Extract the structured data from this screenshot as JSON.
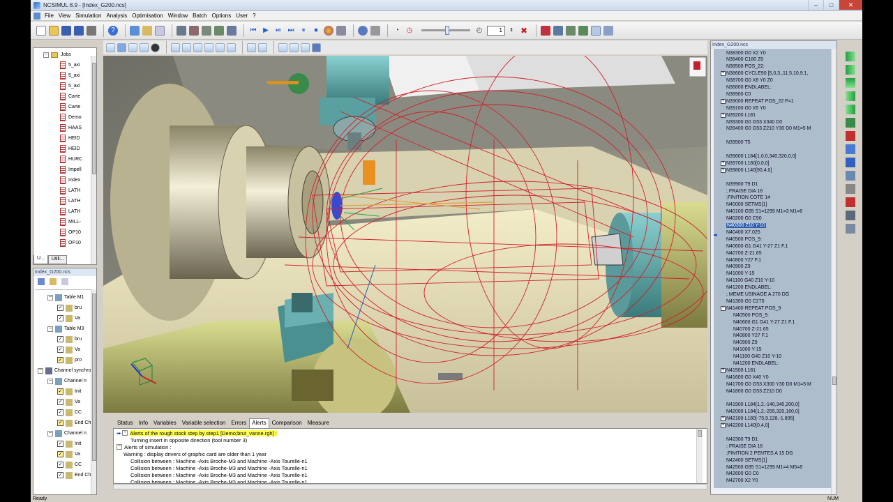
{
  "window": {
    "title": "NCSIMUL 8.9 - [Index_G200.ncs]",
    "minimize": "–",
    "maximize": "□",
    "close": "✕"
  },
  "menu": [
    "File",
    "View",
    "Simulation",
    "Analysis",
    "Optimisation",
    "Window",
    "Batch",
    "Options",
    "User",
    "?"
  ],
  "toolbar": {
    "step_value": "1"
  },
  "left": {
    "jobs_root": "Jobs",
    "jobs": [
      "5_axi",
      "5_axi",
      "5_axi",
      "Carte",
      "Carte",
      "Demo",
      "HAAS",
      "HEID",
      "HEID",
      "HURC",
      "Impell",
      "Index",
      "LATH",
      "LATH",
      "LATH",
      "MILL-",
      "OP10",
      "OP10"
    ],
    "tabs": [
      "U...",
      "Utili..."
    ],
    "file_panel_title": "Index_G200.ncs",
    "tree": [
      {
        "label": "Table M1",
        "level": 1
      },
      {
        "label": "bru",
        "level": 2
      },
      {
        "label": "Va",
        "level": 2
      },
      {
        "label": "Table M3",
        "level": 1
      },
      {
        "label": "bru",
        "level": 2
      },
      {
        "label": "Va",
        "level": 2
      },
      {
        "label": "pro",
        "level": 2
      },
      {
        "label": "Channel synchro",
        "level": 0
      },
      {
        "label": "Channel n",
        "level": 1
      },
      {
        "label": "Init",
        "level": 2
      },
      {
        "label": "Va",
        "level": 2
      },
      {
        "label": "CC",
        "level": 2
      },
      {
        "label": "End Ch",
        "level": 2
      },
      {
        "label": "Channel n",
        "level": 1
      },
      {
        "label": "Init",
        "level": 2
      },
      {
        "label": "Va",
        "level": 2
      },
      {
        "label": "CC",
        "level": 2
      },
      {
        "label": "End Ch",
        "level": 2
      }
    ]
  },
  "bottom": {
    "tabs": [
      "Status",
      "Info",
      "Variables",
      "Variable selection",
      "Errors",
      "Alerts",
      "Comparison",
      "Measure"
    ],
    "active_tab": "Alerts",
    "alerts": [
      {
        "text": "Alerts of the rough stock step by step1 [Demo;brut_vanne.rgh] :",
        "indent": 0,
        "highlight": true,
        "toggle": "−"
      },
      {
        "text": "Turning insert in opposite direction (tool number 3)",
        "indent": 2,
        "highlight": false
      },
      {
        "text": "Alerts of simulation :",
        "indent": 0,
        "highlight": false,
        "toggle": "−"
      },
      {
        "text": "Warning : display drivers of graphic card are older than 1 year",
        "indent": 1,
        "highlight": false
      },
      {
        "text": "Collision between : Machine -Axis Broche-M3 and Machine -Axis Tourelle-n1",
        "indent": 2,
        "highlight": false
      },
      {
        "text": "Collision between : Machine -Axis Broche-M3 and Machine -Axis Tourelle-n1",
        "indent": 2,
        "highlight": false
      },
      {
        "text": "Collision between : Machine -Axis Broche-M3 and Machine -Axis Tourelle-n1",
        "indent": 2,
        "highlight": false
      },
      {
        "text": "Collision between : Machine -Axis Broche-M3 and Machine -Axis Tourelle-n1",
        "indent": 2,
        "highlight": false
      }
    ]
  },
  "code": {
    "title": "Index_G200.ncs",
    "lines": [
      {
        "t": "N38300 G0 X2 Y0",
        "exp": "",
        "ind": 0
      },
      {
        "t": "N38400 C180 Z0",
        "exp": "",
        "ind": 0
      },
      {
        "t": "N38500 POS_22:",
        "exp": "",
        "ind": 0
      },
      {
        "t": "N38600 CYCLE90 [5,0,3,,11.5,10,9.1,",
        "exp": "+",
        "ind": 0
      },
      {
        "t": "N38700 G0 X8 Y0 Z0",
        "exp": "",
        "ind": 0
      },
      {
        "t": "N38800 ENDLABEL:",
        "exp": "",
        "ind": 0
      },
      {
        "t": "N38900 C0",
        "exp": "",
        "ind": 0
      },
      {
        "t": "N39000 REPEAT POS_22 P=1",
        "exp": "+",
        "ind": 0
      },
      {
        "t": "N39100 G0 X5 Y0",
        "exp": "",
        "ind": 0
      },
      {
        "t": "N39200 L181",
        "exp": "+",
        "ind": 0
      },
      {
        "t": "N39300 G0 G53 X340 D0",
        "exp": "",
        "ind": 0
      },
      {
        "t": "N39400 G0 G53 Z210 Y30 D0 M1=5 M",
        "exp": "",
        "ind": 0
      },
      {
        "t": "",
        "exp": "",
        "ind": 0
      },
      {
        "t": "N39500 T5",
        "exp": "",
        "ind": 0
      },
      {
        "t": "",
        "exp": "",
        "ind": 0
      },
      {
        "t": "N39600 L184[1,0,0,340,320,0,0]",
        "exp": "",
        "ind": 0
      },
      {
        "t": "N39700 L180[0,0,0]",
        "exp": "+",
        "ind": 0
      },
      {
        "t": "N39800 L140[90,4,0]",
        "exp": "+",
        "ind": 0
      },
      {
        "t": "",
        "exp": "",
        "ind": 0
      },
      {
        "t": "N39900 T9 D1",
        "exp": "",
        "ind": 0
      },
      {
        "t": "; FRAISE DIA 16",
        "exp": "",
        "ind": 0
      },
      {
        "t": ";FINITION COTE 14",
        "exp": "",
        "ind": 0
      },
      {
        "t": "N40000 SETMS[1]",
        "exp": "",
        "ind": 0
      },
      {
        "t": "N40100 G95 S1=1295 M1=3 M1=8",
        "exp": "",
        "ind": 0
      },
      {
        "t": "N40200 G0 C90",
        "exp": "",
        "ind": 0
      },
      {
        "t": "N40300 Z10 Y-10",
        "exp": "",
        "ind": 0,
        "sel": true
      },
      {
        "t": "N40400 X7.025",
        "exp": "",
        "ind": 0
      },
      {
        "t": "N40500 POS_9:",
        "exp": "",
        "ind": 0
      },
      {
        "t": "N40600 G1 G41 Y-27 Z1 F.1",
        "exp": "",
        "ind": 0
      },
      {
        "t": "N40700 Z-21.65",
        "exp": "",
        "ind": 0
      },
      {
        "t": "N40800 Y27 F.1",
        "exp": "",
        "ind": 0
      },
      {
        "t": "N40900 Z9",
        "exp": "",
        "ind": 0
      },
      {
        "t": "N41000 Y-15",
        "exp": "",
        "ind": 0
      },
      {
        "t": "N41100 G40 Z10 Y-10",
        "exp": "",
        "ind": 0
      },
      {
        "t": "N41200 ENDLABEL:",
        "exp": "",
        "ind": 0
      },
      {
        "t": "; MEME USINAGE A 270 DG",
        "exp": "",
        "ind": 0
      },
      {
        "t": "N41300 G0 C270",
        "exp": "",
        "ind": 0
      },
      {
        "t": "N41400 REPEAT POS_9",
        "exp": "−",
        "ind": 0
      },
      {
        "t": "N40500 POS_9:",
        "exp": "",
        "ind": 1
      },
      {
        "t": "N40600 G1 G41 Y-27 Z1 F.1",
        "exp": "",
        "ind": 1
      },
      {
        "t": "N40700 Z-21.65",
        "exp": "",
        "ind": 1
      },
      {
        "t": "N40800 Y27 F.1",
        "exp": "",
        "ind": 1
      },
      {
        "t": "N40900 Z9",
        "exp": "",
        "ind": 1
      },
      {
        "t": "N41000 Y-15",
        "exp": "",
        "ind": 1
      },
      {
        "t": "N41100 G40 Z10 Y-10",
        "exp": "",
        "ind": 1
      },
      {
        "t": "N41200 ENDLABEL:",
        "exp": "",
        "ind": 1
      },
      {
        "t": "N41500 L181",
        "exp": "+",
        "ind": 0
      },
      {
        "t": "N41600 G0 X40 Y0",
        "exp": "",
        "ind": 0
      },
      {
        "t": "N41700 G0 G53 X300 Y30 D0 M1=5 M",
        "exp": "",
        "ind": 0
      },
      {
        "t": "N41800 G0 G53 Z210 D0",
        "exp": "",
        "ind": 0
      },
      {
        "t": "",
        "exp": "",
        "ind": 0
      },
      {
        "t": "N41900 L184[1,2,-140,340,200,0]",
        "exp": "",
        "ind": 0
      },
      {
        "t": "N42000 L184[1,2,-255,320,160,0]",
        "exp": "",
        "ind": 0
      },
      {
        "t": "N42100 L180[-75,9,128,-1.895]",
        "exp": "+",
        "ind": 0
      },
      {
        "t": "N42200 L140[0,4,0]",
        "exp": "+",
        "ind": 0
      },
      {
        "t": "",
        "exp": "",
        "ind": 0
      },
      {
        "t": "N42300 T9 D1",
        "exp": "",
        "ind": 0
      },
      {
        "t": "; FRAISE DIA 16",
        "exp": "",
        "ind": 0
      },
      {
        "t": ";FINITION 2 PENTES A 15 DG",
        "exp": "",
        "ind": 0
      },
      {
        "t": "N42400 SETMS[1]",
        "exp": "",
        "ind": 0
      },
      {
        "t": "N42500 G95 S1=1295 M1=4 M5=8",
        "exp": "",
        "ind": 0
      },
      {
        "t": "N42600 G0 C0",
        "exp": "",
        "ind": 0
      },
      {
        "t": "N42700 X2 Y0",
        "exp": "",
        "ind": 0
      }
    ]
  },
  "status": {
    "left": "Ready",
    "num": "NUM"
  },
  "colors": {
    "accent": "#2f5faa",
    "highlight": "#ffff55",
    "toolpath": "#d0202a"
  }
}
